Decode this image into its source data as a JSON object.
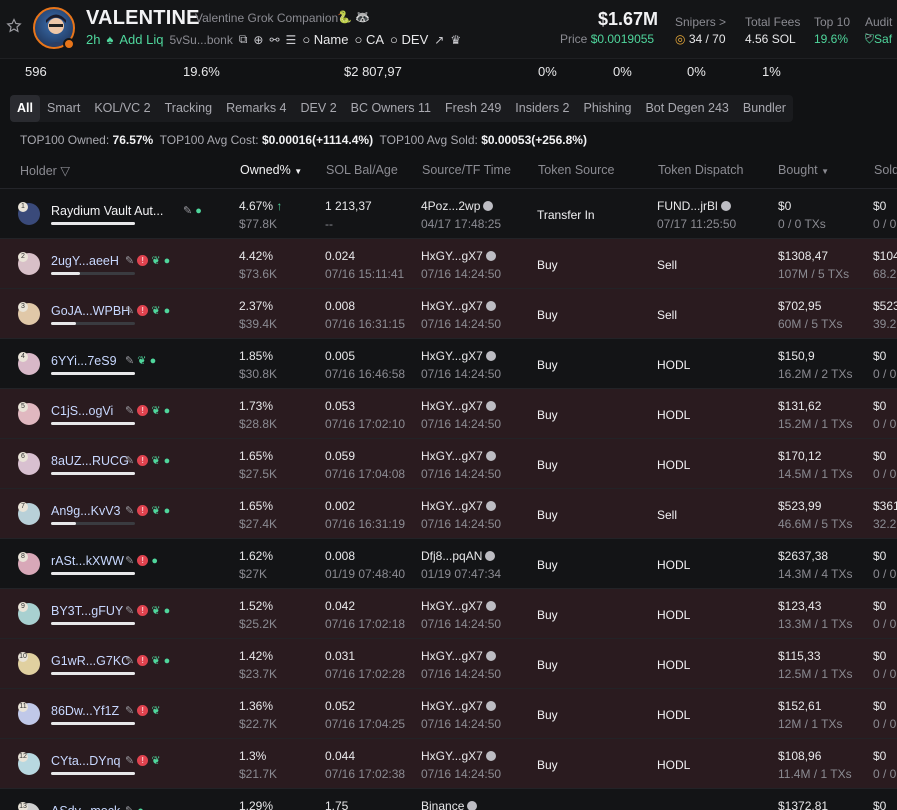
{
  "token": {
    "name": "VALENTINE",
    "subtitle": "Valentine Grok Companion",
    "age": "2h",
    "add_liq": "Add Liq",
    "address": "5vSu...bonk",
    "search_name": "Name",
    "search_ca": "CA",
    "search_dev": "DEV"
  },
  "market": {
    "mcap": "$1.67M",
    "price_label": "Price",
    "price": "$0.0019055"
  },
  "stats": [
    {
      "label": "Snipers >",
      "value": "34 / 70"
    },
    {
      "label": "Total Fees",
      "value": "4.56 SOL"
    },
    {
      "label": "Top 10",
      "value": "19.6%"
    },
    {
      "label": "Audit >",
      "value": "Saf"
    }
  ],
  "strip": [
    "596",
    "19.6%",
    "$2 807,97",
    "0%",
    "0%",
    "0%",
    "1%"
  ],
  "tabs": [
    {
      "label": "All",
      "active": true
    },
    {
      "label": "Smart"
    },
    {
      "label": "KOL/VC 2"
    },
    {
      "label": "Tracking"
    },
    {
      "label": "Remarks 4"
    },
    {
      "label": "DEV 2"
    },
    {
      "label": "BC Owners 11"
    },
    {
      "label": "Fresh 249"
    },
    {
      "label": "Insiders 2"
    },
    {
      "label": "Phishing"
    },
    {
      "label": "Bot Degen 243"
    },
    {
      "label": "Bundler"
    }
  ],
  "summary": {
    "owned_label": "TOP100 Owned:",
    "owned": "76.57%",
    "avg_cost_label": "TOP100 Avg Cost:",
    "avg_cost": "$0.00016",
    "avg_cost_change": "(+1114.4%)",
    "avg_sold_label": "TOP100 Avg Sold:",
    "avg_sold": "$0.00053",
    "avg_sold_change": "(+256.8%)"
  },
  "columns": [
    "Holder",
    "Owned%",
    "SOL Bal/Age",
    "Source/TF Time",
    "Token Source",
    "Token Dispatch",
    "Bought",
    "Sold"
  ],
  "holders": [
    {
      "rank": "1",
      "name": "Raydium Vault Aut...",
      "owned": "4.67%",
      "owned_usd": "$77.8K",
      "bal": "1 213,37",
      "age": "--",
      "src": "4Poz...2wp",
      "src_time": "04/17 17:48:25",
      "token_source": "Transfer In",
      "dispatch": "FUND...jrBl",
      "dispatch_time": "07/17 11:25:50",
      "bought": "$0",
      "bought_sub": "0 / 0 TXs",
      "sold": "$0",
      "sold_sub": "0 / 0",
      "bar": 1.0,
      "style": "dark",
      "tags": "user"
    },
    {
      "rank": "2",
      "name": "2ugY...aeeH",
      "owned": "4.42%",
      "owned_usd": "$73.6K",
      "bal": "0.024",
      "age": "07/16 15:11:41",
      "src": "HxGY...gX7",
      "src_time": "07/16 14:24:50",
      "token_source": "Buy",
      "dispatch": "Sell",
      "bought": "$1308,47",
      "bought_sub": "107M / 5 TXs",
      "sold": "$104",
      "sold_sub": "68.2",
      "bar": 0.35,
      "style": "red",
      "tags": "all"
    },
    {
      "rank": "3",
      "name": "GoJA...WPBH",
      "owned": "2.37%",
      "owned_usd": "$39.4K",
      "bal": "0.008",
      "age": "07/16 16:31:15",
      "src": "HxGY...gX7",
      "src_time": "07/16 14:24:50",
      "token_source": "Buy",
      "dispatch": "Sell",
      "bought": "$702,95",
      "bought_sub": "60M / 5 TXs",
      "sold": "$523",
      "sold_sub": "39.2",
      "bar": 0.3,
      "style": "red",
      "tags": "all"
    },
    {
      "rank": "4",
      "name": "6YYi...7eS9",
      "owned": "1.85%",
      "owned_usd": "$30.8K",
      "bal": "0.005",
      "age": "07/16 16:46:58",
      "src": "HxGY...gX7",
      "src_time": "07/16 14:24:50",
      "token_source": "Buy",
      "dispatch": "HODL",
      "bought": "$150,9",
      "bought_sub": "16.2M / 2 TXs",
      "sold": "$0",
      "sold_sub": "0 / 0",
      "bar": 1.0,
      "style": "dark",
      "tags": "leafuser"
    },
    {
      "rank": "5",
      "name": "C1jS...ogVi",
      "owned": "1.73%",
      "owned_usd": "$28.8K",
      "bal": "0.053",
      "age": "07/16 17:02:10",
      "src": "HxGY...gX7",
      "src_time": "07/16 14:24:50",
      "token_source": "Buy",
      "dispatch": "HODL",
      "bought": "$131,62",
      "bought_sub": "15.2M / 1 TXs",
      "sold": "$0",
      "sold_sub": "0 / 0",
      "bar": 1.0,
      "style": "red",
      "tags": "all"
    },
    {
      "rank": "6",
      "name": "8aUZ...RUCG",
      "owned": "1.65%",
      "owned_usd": "$27.5K",
      "bal": "0.059",
      "age": "07/16 17:04:08",
      "src": "HxGY...gX7",
      "src_time": "07/16 14:24:50",
      "token_source": "Buy",
      "dispatch": "HODL",
      "bought": "$170,12",
      "bought_sub": "14.5M / 1 TXs",
      "sold": "$0",
      "sold_sub": "0 / 0",
      "bar": 1.0,
      "style": "red",
      "tags": "all"
    },
    {
      "rank": "7",
      "name": "An9g...KvV3",
      "owned": "1.65%",
      "owned_usd": "$27.4K",
      "bal": "0.002",
      "age": "07/16 16:31:19",
      "src": "HxGY...gX7",
      "src_time": "07/16 14:24:50",
      "token_source": "Buy",
      "dispatch": "Sell",
      "bought": "$523,99",
      "bought_sub": "46.6M / 5 TXs",
      "sold": "$361",
      "sold_sub": "32.2",
      "bar": 0.3,
      "style": "red",
      "tags": "all"
    },
    {
      "rank": "8",
      "name": "rASt...kXWW",
      "owned": "1.62%",
      "owned_usd": "$27K",
      "bal": "0.008",
      "age": "01/19 07:48:40",
      "src": "Dfj8...pqAN",
      "src_time": "01/19 07:47:34",
      "token_source": "Buy",
      "dispatch": "HODL",
      "bought": "$2637,38",
      "bought_sub": "14.3M / 4 TXs",
      "sold": "$0",
      "sold_sub": "0 / 0",
      "bar": 1.0,
      "style": "dark",
      "tags": "warnuser"
    },
    {
      "rank": "9",
      "name": "BY3T...gFUY",
      "owned": "1.52%",
      "owned_usd": "$25.2K",
      "bal": "0.042",
      "age": "07/16 17:02:18",
      "src": "HxGY...gX7",
      "src_time": "07/16 14:24:50",
      "token_source": "Buy",
      "dispatch": "HODL",
      "bought": "$123,43",
      "bought_sub": "13.3M / 1 TXs",
      "sold": "$0",
      "sold_sub": "0 / 0",
      "bar": 1.0,
      "style": "red",
      "tags": "all"
    },
    {
      "rank": "10",
      "name": "G1wR...G7KC",
      "owned": "1.42%",
      "owned_usd": "$23.7K",
      "bal": "0.031",
      "age": "07/16 17:02:28",
      "src": "HxGY...gX7",
      "src_time": "07/16 14:24:50",
      "token_source": "Buy",
      "dispatch": "HODL",
      "bought": "$115,33",
      "bought_sub": "12.5M / 1 TXs",
      "sold": "$0",
      "sold_sub": "0 / 0",
      "bar": 1.0,
      "style": "red",
      "tags": "all"
    },
    {
      "rank": "11",
      "name": "86Dw...Yf1Z",
      "owned": "1.36%",
      "owned_usd": "$22.7K",
      "bal": "0.052",
      "age": "07/16 17:04:25",
      "src": "HxGY...gX7",
      "src_time": "07/16 14:24:50",
      "token_source": "Buy",
      "dispatch": "HODL",
      "bought": "$152,61",
      "bought_sub": "12M / 1 TXs",
      "sold": "$0",
      "sold_sub": "0 / 0",
      "bar": 1.0,
      "style": "red",
      "tags": "warnleaf"
    },
    {
      "rank": "12",
      "name": "CYta...DYnq",
      "owned": "1.3%",
      "owned_usd": "$21.7K",
      "bal": "0.044",
      "age": "07/16 17:02:38",
      "src": "HxGY...gX7",
      "src_time": "07/16 14:24:50",
      "token_source": "Buy",
      "dispatch": "HODL",
      "bought": "$108,96",
      "bought_sub": "11.4M / 1 TXs",
      "sold": "$0",
      "sold_sub": "0 / 0",
      "bar": 1.0,
      "style": "red",
      "tags": "warnleaf"
    },
    {
      "rank": "13",
      "name": "ASdy...mock",
      "owned": "1.29%",
      "owned_usd": "",
      "bal": "1.75",
      "age": "",
      "src": "Binance",
      "src_time": "",
      "token_source": "",
      "dispatch": "",
      "bought": "$1372,81",
      "bought_sub": "",
      "sold": "$0",
      "sold_sub": "",
      "bar": 1.0,
      "style": "dark",
      "tags": "user"
    }
  ]
}
